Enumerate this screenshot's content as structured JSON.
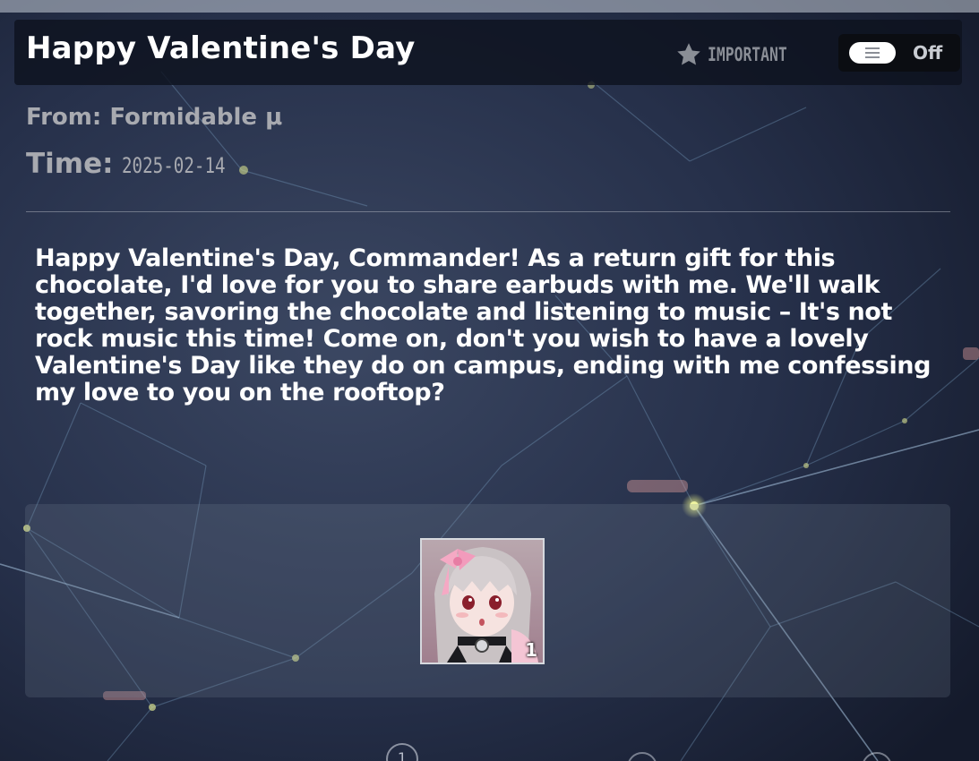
{
  "mail": {
    "title": "Happy Valentine's Day",
    "important_label": "IMPORTANT",
    "toggle_state": "Off",
    "from": "From: Formidable μ",
    "time_label": "Time:",
    "time_value": "2025-02-14",
    "body": "Happy Valentine's Day, Commander! As a return gift for this chocolate, I'd love for you to share earbuds with me. We'll walk together, savoring the chocolate and listening to music – It's not rock music this time! Come on, don't you wish to have a lovely Valentine's Day like they do on campus, ending with me confessing my love to you on the rooftop?"
  },
  "attachments": [
    {
      "icon": "character-portrait-icon",
      "count": "1"
    }
  ],
  "pager": {
    "current": "1"
  },
  "colors": {
    "header_bg": "#0e121e",
    "text_primary": "#ffffff",
    "text_muted": "#a8aab0",
    "toggle_bg": "#0b0d12"
  }
}
